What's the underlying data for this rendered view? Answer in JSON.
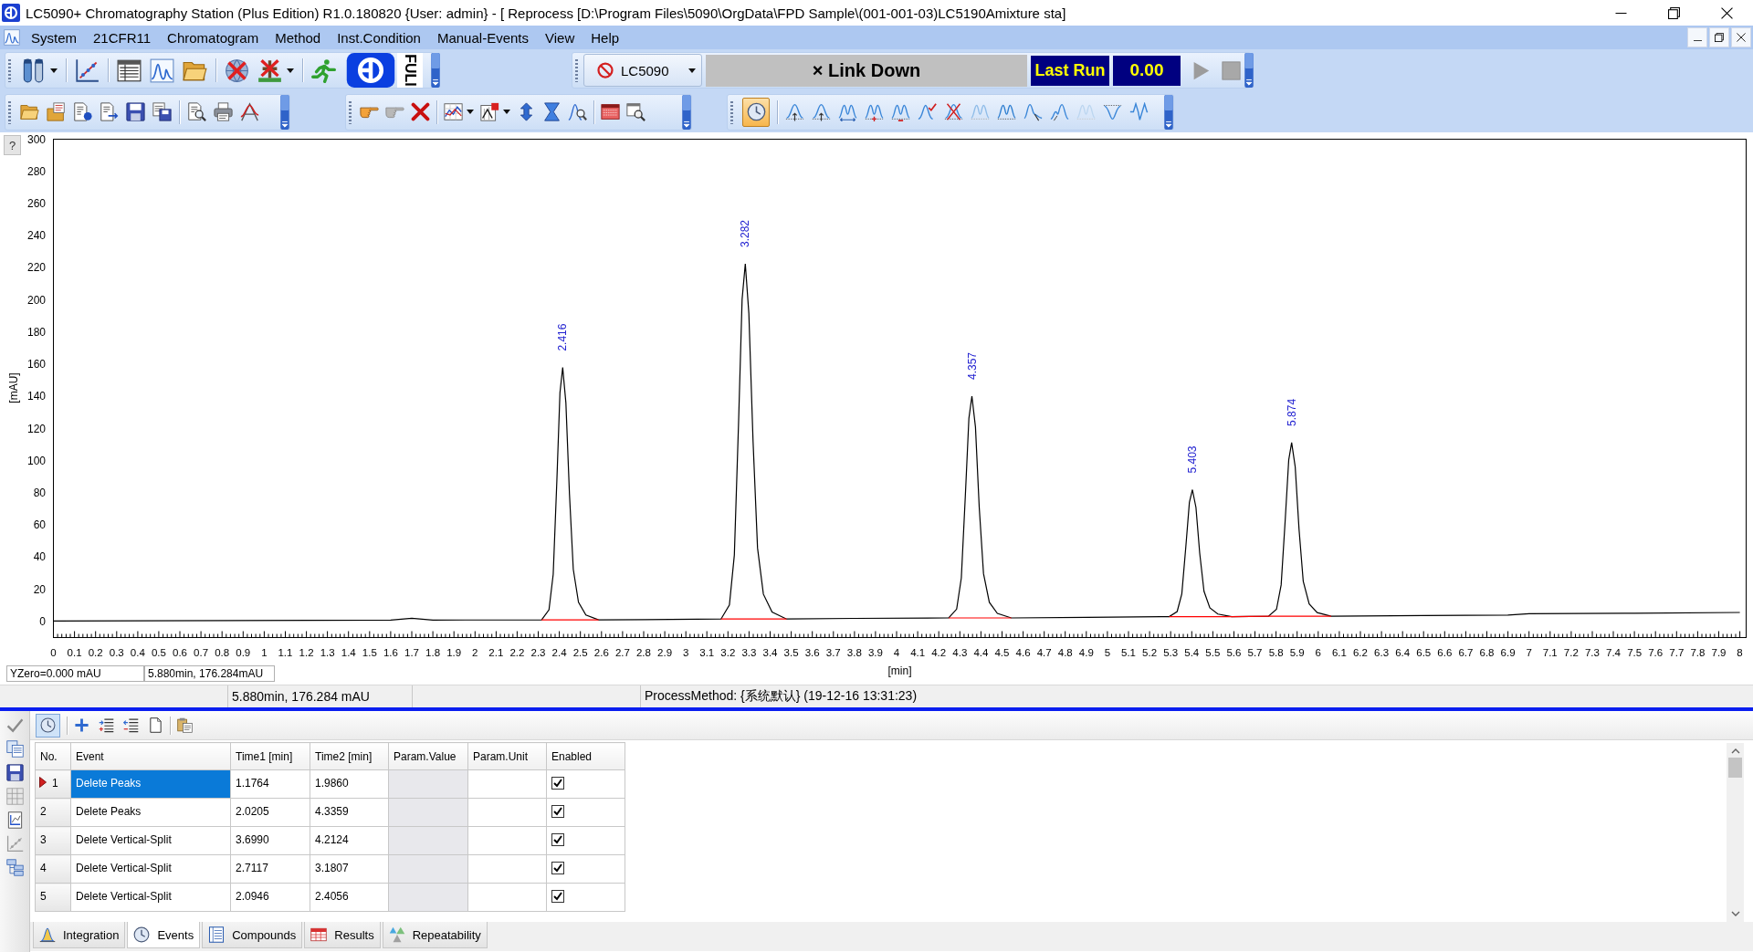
{
  "window": {
    "title": "LC5090+ Chromatography Station (Plus Edition) R1.0.180820 {User: admin} - [ Reprocess [D:\\Program Files\\5090\\OrgData\\FPD Sample\\(001-001-03)LC5190Amixture sta]"
  },
  "menu": [
    "System",
    "21CFR11",
    "Chromatogram",
    "Method",
    "Inst.Condition",
    "Manual-Events",
    "View",
    "Help"
  ],
  "toolbar": {
    "logo_text": "FULI",
    "instrument": "LC5090",
    "link_status": "× Link Down",
    "last_run_label": "Last Run",
    "last_run_value": "0.00",
    "run_disabled": true
  },
  "peak_toolbar": {
    "clock_pressed": true
  },
  "chart": {
    "help_button": "?",
    "y_zero": "YZero=0.000 mAU",
    "cursor_readout": "5.880min, 176.284mAU",
    "chart_data": {
      "type": "line",
      "xlabel": "[min]",
      "ylabel": "[mAU]",
      "x": [
        0,
        1.6,
        1.7,
        1.8,
        2.316,
        2.351,
        2.371,
        2.388,
        2.403,
        2.416,
        2.431,
        2.448,
        2.466,
        2.491,
        2.526,
        2.586,
        2.8,
        3.167,
        3.207,
        3.23,
        3.25,
        3.267,
        3.282,
        3.299,
        3.319,
        3.34,
        3.368,
        3.409,
        3.478,
        3.8,
        4.247,
        4.285,
        4.307,
        4.326,
        4.343,
        4.357,
        4.374,
        4.392,
        4.412,
        4.44,
        4.478,
        4.544,
        4.9,
        5.293,
        5.331,
        5.353,
        5.372,
        5.389,
        5.403,
        5.42,
        5.438,
        5.458,
        5.486,
        5.524,
        5.59,
        5.764,
        5.802,
        5.824,
        5.843,
        5.86,
        5.874,
        5.891,
        5.909,
        5.929,
        5.957,
        5.995,
        6.061,
        6.5,
        6.9,
        7,
        7.5,
        8
      ],
      "series": [
        {
          "color": "#000000",
          "values": [
            0.3,
            0.9,
            2.0,
            0.9,
            1.0,
            7.3,
            29.3,
            87.4,
            142.3,
            158.0,
            136.0,
            79.5,
            32.4,
            12.0,
            4.1,
            1.0,
            1.2,
            1.5,
            10.3,
            41.3,
            123.1,
            200.4,
            222.5,
            191.6,
            112.0,
            45.7,
            17.0,
            5.9,
            1.5,
            1.9,
            2.2,
            7.7,
            27.0,
            78.1,
            126.4,
            140.2,
            120.9,
            71.2,
            29.8,
            11.9,
            5.0,
            2.2,
            2.6,
            3.0,
            6.2,
            17.2,
            46.5,
            74.1,
            82.0,
            70.9,
            42.5,
            18.8,
            8.5,
            4.6,
            3.0,
            3.3,
            7.6,
            22.7,
            62.7,
            100.5,
            111.3,
            96.2,
            57.3,
            24.9,
            10.9,
            5.5,
            3.3,
            3.7,
            4.0,
            4.8,
            5.1,
            5.6
          ]
        },
        {
          "color": "#ff0000",
          "values": [
            null,
            null,
            null,
            null,
            1.0,
            1.0,
            1.0,
            1.0,
            1.0,
            1.0,
            1.0,
            1.0,
            1.0,
            1.0,
            1.0,
            1.0,
            null,
            1.5,
            1.5,
            1.5,
            1.5,
            1.5,
            1.5,
            1.5,
            1.5,
            1.5,
            1.5,
            1.5,
            1.5,
            null,
            2.2,
            2.2,
            2.2,
            2.2,
            2.2,
            2.2,
            2.2,
            2.2,
            2.2,
            2.2,
            2.2,
            2.2,
            null,
            3.0,
            3.0,
            3.0,
            3.0,
            3.0,
            3.0,
            3.0,
            3.0,
            3.0,
            3.0,
            3.0,
            3.0,
            3.3,
            3.3,
            3.3,
            3.3,
            3.3,
            3.3,
            3.3,
            3.3,
            3.3,
            3.3,
            3.3,
            3.3,
            null,
            null,
            null,
            null,
            null
          ]
        }
      ],
      "xlim": [
        0,
        8.03
      ],
      "ylim": [
        -10,
        300
      ],
      "xticks": [
        0,
        0.1,
        0.2,
        0.3,
        0.4,
        0.5,
        0.6,
        0.7,
        0.8,
        0.9,
        1,
        1.1,
        1.2,
        1.3,
        1.4,
        1.5,
        1.6,
        1.7,
        1.8,
        1.9,
        2,
        2.1,
        2.2,
        2.3,
        2.4,
        2.5,
        2.6,
        2.7,
        2.8,
        2.9,
        3,
        3.1,
        3.2,
        3.3,
        3.4,
        3.5,
        3.6,
        3.7,
        3.8,
        3.9,
        4,
        4.1,
        4.2,
        4.3,
        4.4,
        4.5,
        4.6,
        4.7,
        4.8,
        4.9,
        5,
        5.1,
        5.2,
        5.3,
        5.4,
        5.5,
        5.6,
        5.7,
        5.8,
        5.9,
        6,
        6.1,
        6.2,
        6.3,
        6.4,
        6.5,
        6.6,
        6.7,
        6.8,
        6.9,
        7,
        7.1,
        7.2,
        7.3,
        7.4,
        7.5,
        7.6,
        7.7,
        7.8,
        7.9,
        8
      ],
      "yticks": [
        0,
        20,
        40,
        60,
        80,
        100,
        120,
        140,
        160,
        180,
        200,
        220,
        240,
        260,
        280,
        300
      ],
      "annotations": [
        {
          "x": 2.416,
          "y": 158.0,
          "text": "2.416"
        },
        {
          "x": 3.282,
          "y": 222.5,
          "text": "3.282"
        },
        {
          "x": 4.357,
          "y": 140.2,
          "text": "4.357"
        },
        {
          "x": 5.403,
          "y": 82.0,
          "text": "5.403"
        },
        {
          "x": 5.874,
          "y": 111.3,
          "text": "5.874"
        }
      ]
    }
  },
  "status_bar": {
    "cursor": "5.880min, 176.284 mAU",
    "process_method": "ProcessMethod: {系统默认} (19-12-16 13:31:23)"
  },
  "events_toolbar": {
    "clock_pressed": true
  },
  "table": {
    "columns": [
      "No.",
      "Event",
      "Time1 [min]",
      "Time2 [min]",
      "Param.Value",
      "Param.Unit",
      "Enabled"
    ],
    "rows": [
      {
        "no": "1",
        "event": "Delete Peaks",
        "time1": "1.1764",
        "time2": "1.9860",
        "enabled": true,
        "current": true,
        "selected": true
      },
      {
        "no": "2",
        "event": "Delete Peaks",
        "time1": "2.0205",
        "time2": "4.3359",
        "enabled": true,
        "current": false,
        "selected": false
      },
      {
        "no": "3",
        "event": "Delete Vertical-Split",
        "time1": "3.6990",
        "time2": "4.2124",
        "enabled": true,
        "current": false,
        "selected": false
      },
      {
        "no": "4",
        "event": "Delete Vertical-Split",
        "time1": "2.7117",
        "time2": "3.1807",
        "enabled": true,
        "current": false,
        "selected": false
      },
      {
        "no": "5",
        "event": "Delete Vertical-Split",
        "time1": "2.0946",
        "time2": "2.4056",
        "enabled": true,
        "current": false,
        "selected": false
      }
    ]
  },
  "tabs": [
    {
      "label": "Integration",
      "selected": false
    },
    {
      "label": "Events",
      "selected": true
    },
    {
      "label": "Compounds",
      "selected": false
    },
    {
      "label": "Results",
      "selected": false
    },
    {
      "label": "Repeatability",
      "selected": false
    }
  ]
}
